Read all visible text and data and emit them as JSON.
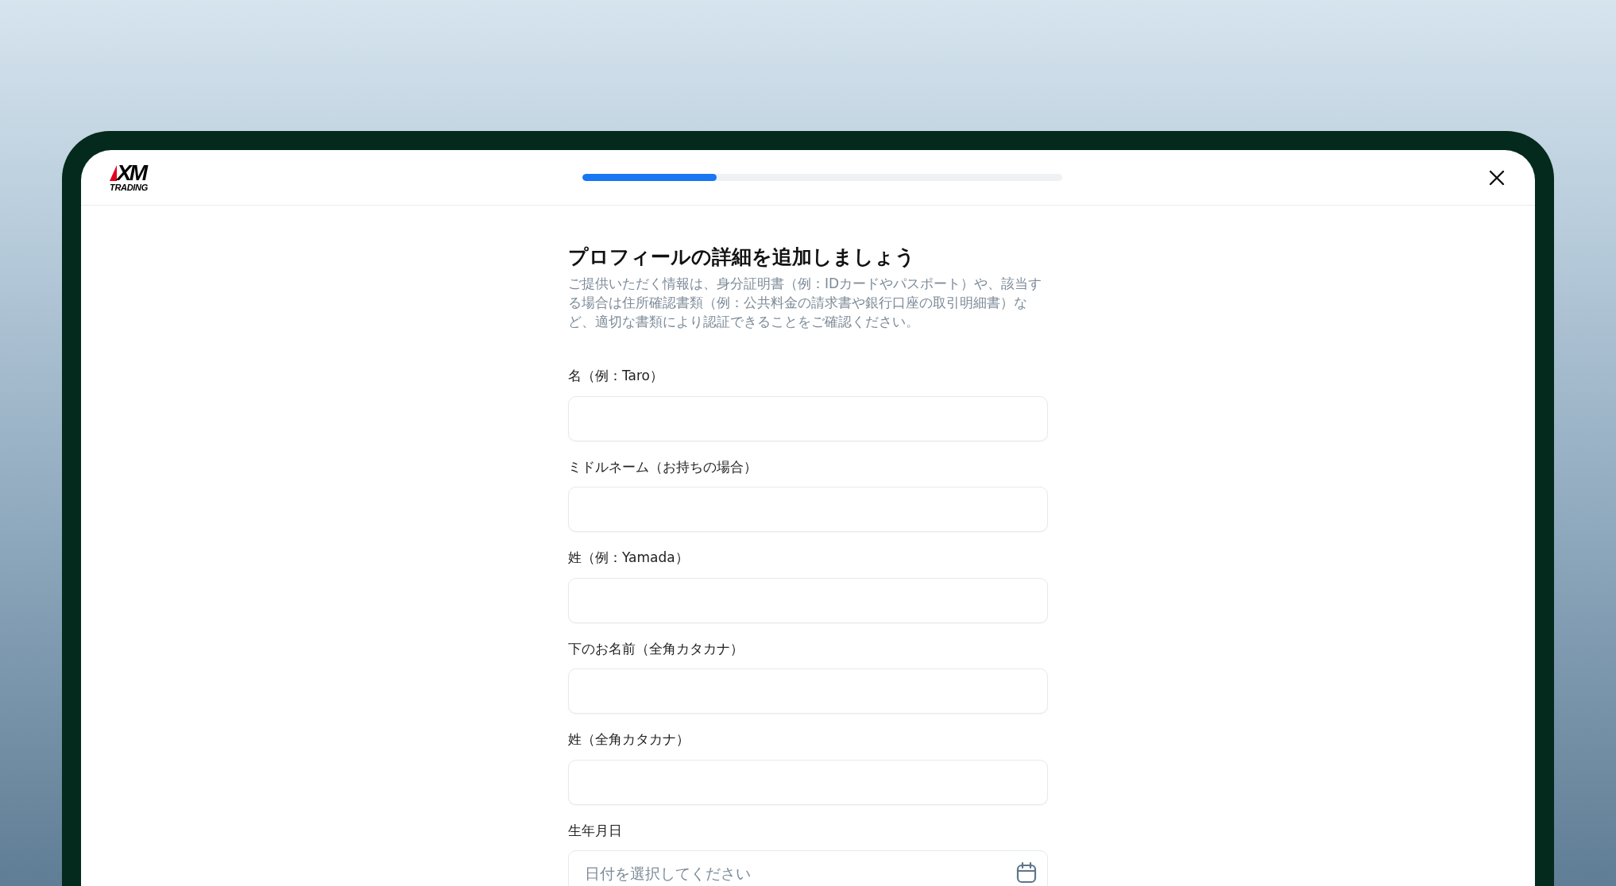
{
  "logo": {
    "mark": "XM",
    "subtitle": "TRADING"
  },
  "progress": {
    "level": 0.28
  },
  "title": "プロフィールの詳細を追加しましょう",
  "description": "ご提供いただく情報は、身分証明書（例：IDカードやパスポート）や、該当する場合は住所確認書類（例：公共料金の請求書や銀行口座の取引明細書）など、適切な書類により認証できることをご確認ください。",
  "fields": [
    {
      "kind": "text",
      "label": "名（例：Taro）"
    },
    {
      "kind": "text",
      "label": "ミドルネーム（お持ちの場合）"
    },
    {
      "kind": "text",
      "label": "姓（例：Yamada）"
    },
    {
      "kind": "text",
      "label": "下のお名前（全角カタカナ）"
    },
    {
      "kind": "text",
      "label": "姓（全角カタカナ）"
    },
    {
      "kind": "date",
      "label": "生年月日",
      "placeholder": "日付を選択してください"
    }
  ]
}
